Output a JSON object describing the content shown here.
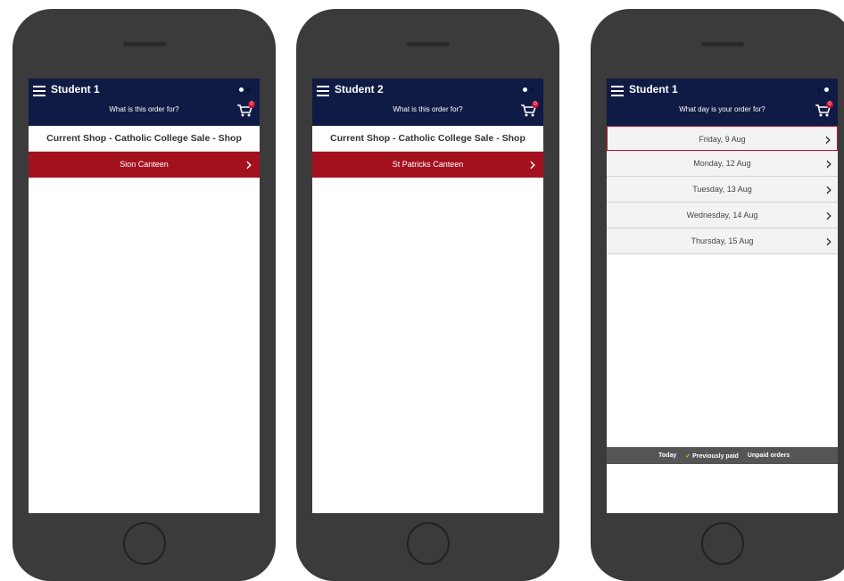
{
  "phones": [
    {
      "student": "Student 1",
      "subtitle": "What is this order for?",
      "cart_count": "0",
      "shop_title": "Current Shop - Catholic College Sale - Shop",
      "canteen": "Sion Canteen"
    },
    {
      "student": "Student 2",
      "subtitle": "What is this order for?",
      "cart_count": "0",
      "shop_title": "Current Shop - Catholic College Sale - Shop",
      "canteen": "St Patricks Canteen"
    },
    {
      "student": "Student 1",
      "subtitle": "What day is your order for?",
      "cart_count": "0",
      "days": [
        "Friday, 9 Aug",
        "Monday, 12 Aug",
        "Tuesday, 13 Aug",
        "Wednesday, 14 Aug",
        "Thursday, 15 Aug"
      ],
      "legend": {
        "today": "Today",
        "paid": "Previously paid",
        "unpaid": "Unpaid orders"
      }
    }
  ],
  "colors": {
    "header_bg": "#0f1b44",
    "canteen_bg": "#a3111f",
    "badge": "#c8102e",
    "legend_bg": "#555555"
  },
  "icons": {
    "menu": "hamburger-icon",
    "cart": "cart-icon",
    "chevron": "chevron-right-icon",
    "check": "check-icon"
  }
}
